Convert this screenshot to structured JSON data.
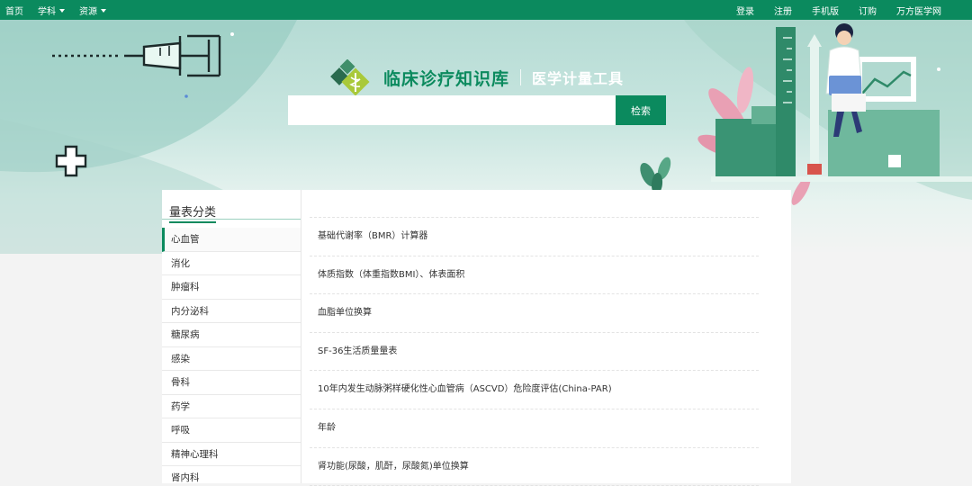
{
  "topnav": {
    "left": [
      {
        "label": "首页",
        "dropdown": false
      },
      {
        "label": "学科",
        "dropdown": true
      },
      {
        "label": "资源",
        "dropdown": true
      }
    ],
    "right": [
      "登录",
      "注册",
      "手机版",
      "订购",
      "万方医学网"
    ]
  },
  "banner": {
    "logo_title": "临床诊疗知识库",
    "logo_subtitle": "医学计量工具"
  },
  "search": {
    "placeholder": "",
    "value": "",
    "button_label": "检索"
  },
  "sidebar": {
    "heading": "量表分类",
    "active_index": 0,
    "categories": [
      "心血管",
      "消化",
      "肿瘤科",
      "内分泌科",
      "糖尿病",
      "感染",
      "骨科",
      "药学",
      "呼吸",
      "精神心理科",
      "肾内科"
    ]
  },
  "items": [
    "基础代谢率（BMR）计算器",
    "体质指数（体重指数BMI）、体表面积",
    "血脂单位换算",
    "SF-36生活质量量表",
    "10年内发生动脉粥样硬化性心血管病（ASCVD）危险度评估(China-PAR)",
    "年龄",
    "肾功能(尿酸，肌酐，尿酸氮)单位换算"
  ],
  "colors": {
    "brand_green": "#0b8a5e",
    "banner_teal": "#b5dbd4",
    "pink_leaf": "#e9a0b4"
  }
}
